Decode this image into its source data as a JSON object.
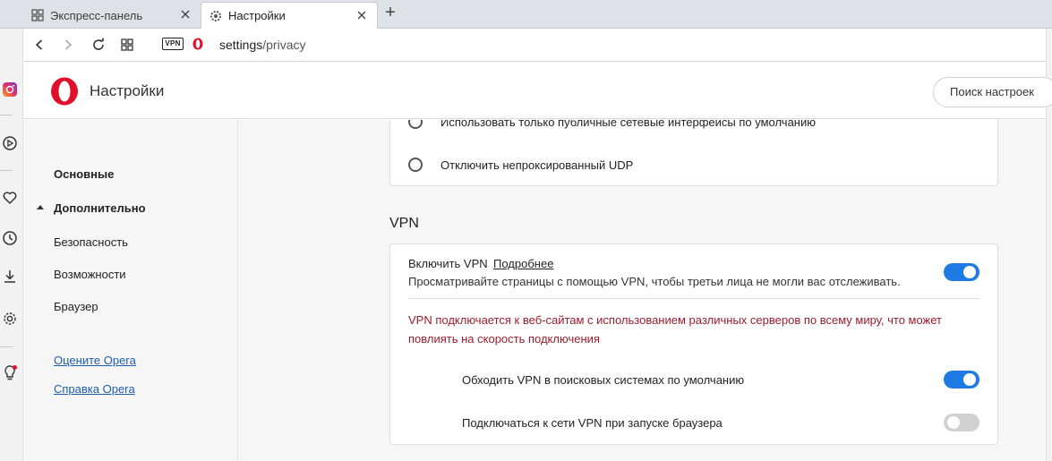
{
  "browser": {
    "tabs": [
      {
        "label": "Экспресс-панель",
        "icon": "grid-icon",
        "active": false
      },
      {
        "label": "Настройки",
        "icon": "gear-icon",
        "active": true
      }
    ],
    "new_tab_label": "+",
    "address": {
      "vpn_badge": "VPN",
      "url_host": "settings",
      "url_path": "/privacy"
    }
  },
  "settings": {
    "header_title": "Настройки",
    "search_placeholder": "Поиск настроек"
  },
  "nav": {
    "basic": "Основные",
    "advanced": "Дополнительно",
    "items": [
      "Безопасность",
      "Возможности",
      "Браузер"
    ],
    "links": [
      "Оцените Opera",
      "Справка Opera"
    ]
  },
  "webrtc": {
    "option_public": "Использовать только публичные сетевые интерфейсы по умолчанию",
    "option_udp": "Отключить непроксированный UDP"
  },
  "vpn": {
    "heading": "VPN",
    "enable_label": "Включить VPN",
    "more_link": "Подробнее",
    "description": "Просматривайте страницы с помощью VPN, чтобы третьи лица не могли вас отслеживать.",
    "enabled": true,
    "warning_line1": "VPN подключается к веб-сайтам с использованием различных серверов по всему миру, что может",
    "warning_line2": "повлиять на скорость подключения",
    "bypass_label": "Обходить VPN в поисковых системах по умолчанию",
    "bypass_enabled": true,
    "startup_label": "Подключаться к сети VPN при запуске браузера",
    "startup_enabled": false
  },
  "colors": {
    "accent": "#1e7be3",
    "warning": "#9c1c2c",
    "link": "#1f5fae",
    "opera_red": "#e0102a"
  }
}
